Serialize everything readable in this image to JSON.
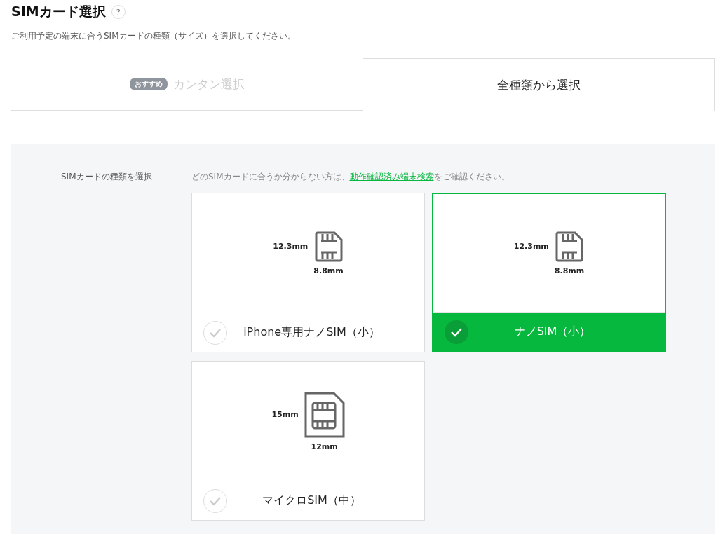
{
  "header": {
    "title": "SIMカード選択",
    "help": "?",
    "description": "ご利用予定の端末に合うSIMカードの種類（サイズ）を選択してください。"
  },
  "tabs": [
    {
      "badge": "おすすめ",
      "label": "カンタン選択",
      "selected": false
    },
    {
      "label": "全種類から選択",
      "selected": true
    }
  ],
  "section": {
    "label": "SIMカードの種類を選択",
    "hint_before": "どのSIMカードに合うか分からない方は、",
    "hint_link": "動作確認済み端末検索",
    "hint_after": "をご確認ください。",
    "cards": [
      {
        "kind": "nano",
        "height": "12.3mm",
        "width": "8.8mm",
        "name": "iPhone専用ナノSIM（小）",
        "selected": false
      },
      {
        "kind": "nano",
        "height": "12.3mm",
        "width": "8.8mm",
        "name": "ナノSIM（小）",
        "selected": true
      },
      {
        "kind": "micro",
        "height": "15mm",
        "width": "12mm",
        "name": "マイクロSIM（中）",
        "selected": false
      }
    ]
  }
}
